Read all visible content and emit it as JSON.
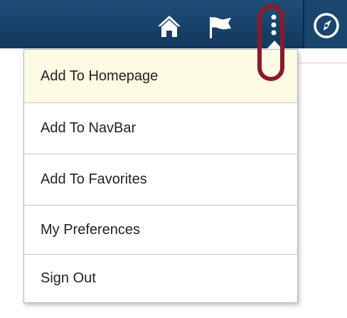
{
  "header": {
    "icons": {
      "home": "home-icon",
      "favorites": "flag-icon",
      "actions": "vertical-ellipsis-icon",
      "navigator": "compass-icon"
    },
    "colors": {
      "bar": "#1f4e79",
      "icon": "#ffffff",
      "highlight": "#8b1a2a"
    }
  },
  "actions_menu": {
    "items": [
      {
        "label": "Add To Homepage",
        "active": true
      },
      {
        "label": "Add To NavBar",
        "active": false
      },
      {
        "label": "Add To Favorites",
        "active": false
      },
      {
        "label": "My Preferences",
        "active": false
      },
      {
        "label": "Sign Out",
        "active": false
      }
    ],
    "colors": {
      "active_background": "#fefbe4",
      "text": "#222222",
      "divider": "#c8c8c8"
    }
  }
}
